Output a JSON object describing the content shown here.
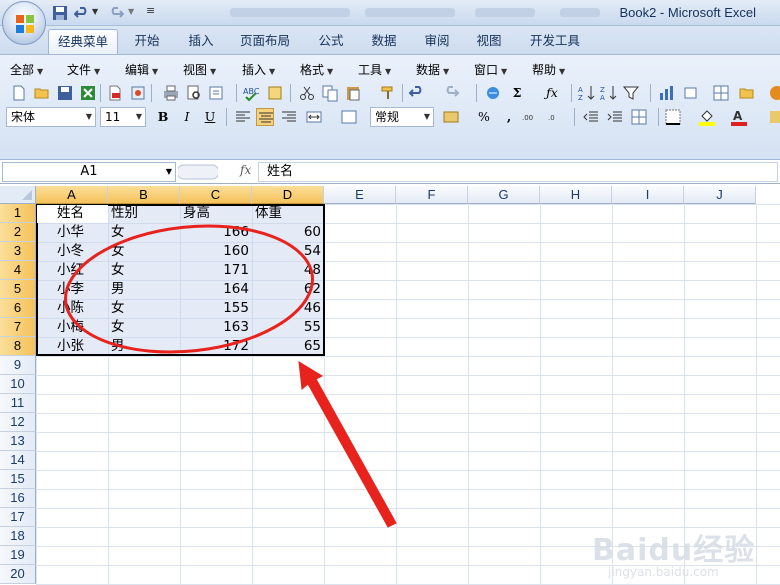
{
  "window": {
    "title": "Book2 - Microsoft Excel"
  },
  "ribbon_tabs": [
    "经典菜单",
    "开始",
    "插入",
    "页面布局",
    "公式",
    "数据",
    "审阅",
    "视图",
    "开发工具"
  ],
  "menus": [
    "全部",
    "文件",
    "编辑",
    "视图",
    "插入",
    "格式",
    "工具",
    "数据",
    "窗口",
    "帮助"
  ],
  "font": {
    "name": "宋体",
    "size": "11"
  },
  "number_format": "常规",
  "name_box": "A1",
  "fx_label": "fx",
  "formula": "姓名",
  "columns": [
    "A",
    "B",
    "C",
    "D",
    "E",
    "F",
    "G",
    "H",
    "I",
    "J"
  ],
  "rows": [
    "1",
    "2",
    "3",
    "4",
    "5",
    "6",
    "7",
    "8",
    "9",
    "10",
    "11",
    "12",
    "13",
    "14",
    "15",
    "16",
    "17",
    "18",
    "19",
    "20"
  ],
  "table": {
    "header": [
      "姓名",
      "性别",
      "身高",
      "体重"
    ],
    "data": [
      [
        "小华",
        "女",
        "166",
        "60"
      ],
      [
        "小冬",
        "女",
        "160",
        "54"
      ],
      [
        "小红",
        "女",
        "171",
        "48"
      ],
      [
        "小李",
        "男",
        "164",
        "62"
      ],
      [
        "小陈",
        "女",
        "155",
        "46"
      ],
      [
        "小梅",
        "女",
        "163",
        "55"
      ],
      [
        "小张",
        "男",
        "172",
        "65"
      ]
    ]
  },
  "watermark": {
    "brand": "Baidu经验",
    "url": "jingyan.baidu.com"
  },
  "colors": {
    "annotation": "#e8221c",
    "selected_header": "#f5c15a",
    "ribbon": "#d5e2f3"
  }
}
